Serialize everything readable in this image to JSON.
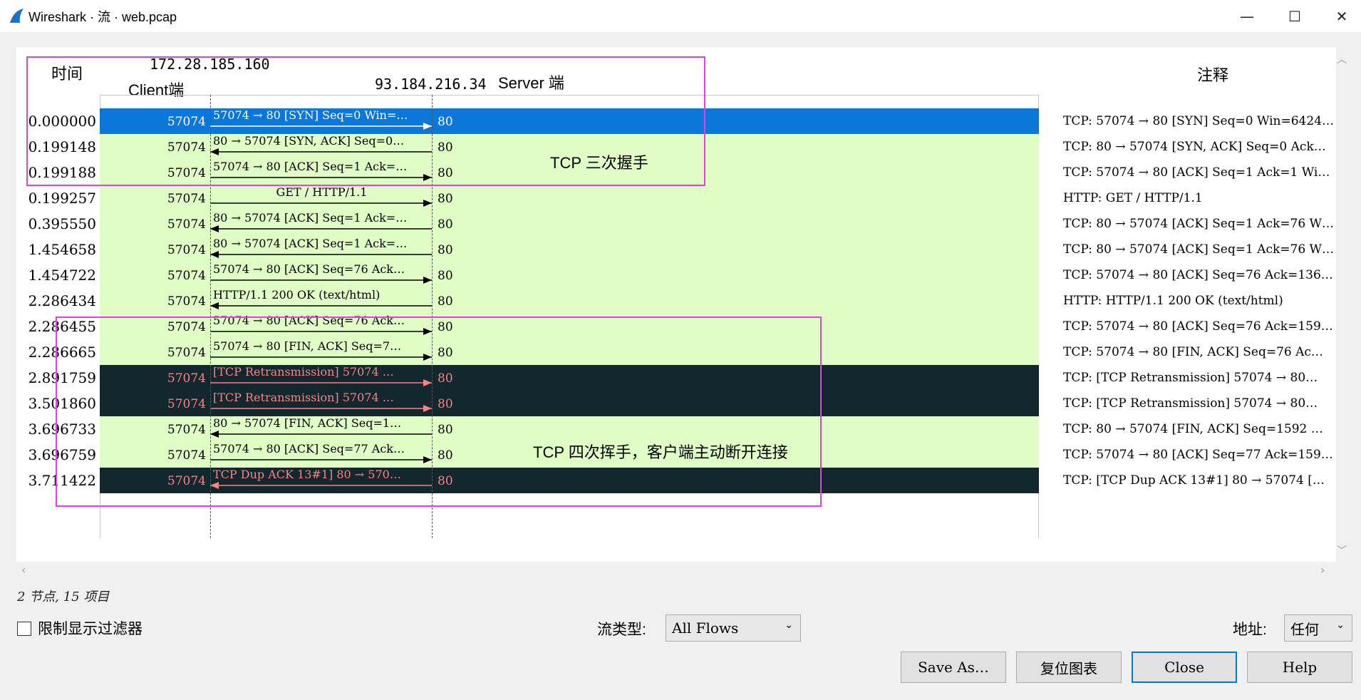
{
  "window": {
    "title": "Wireshark · 流 · web.pcap",
    "minimize": "—",
    "maximize": "☐",
    "close": "✕"
  },
  "header": {
    "time_label": "时间",
    "client_ip": "172.28.185.160",
    "client_label": "Client端",
    "server_ip": "93.184.216.34",
    "server_label": "Server 端",
    "comment_label": "注释"
  },
  "rows": [
    {
      "time": "0.000000",
      "src_port": "57074",
      "dst_port": "80",
      "dir": "right",
      "label": "57074 → 80 [SYN] Seq=0 Win=…",
      "comment": "TCP: 57074 → 80 [SYN] Seq=0 Win=6424…",
      "style": "selected"
    },
    {
      "time": "0.199148",
      "src_port": "57074",
      "dst_port": "80",
      "dir": "left",
      "label": "80 → 57074 [SYN, ACK] Seq=0…",
      "comment": "TCP: 80 → 57074 [SYN, ACK] Seq=0 Ack…",
      "style": "green"
    },
    {
      "time": "0.199188",
      "src_port": "57074",
      "dst_port": "80",
      "dir": "right",
      "label": "57074 → 80 [ACK] Seq=1 Ack=…",
      "comment": "TCP: 57074 → 80 [ACK] Seq=1 Ack=1 Wi…",
      "style": "green"
    },
    {
      "time": "0.199257",
      "src_port": "57074",
      "dst_port": "80",
      "dir": "right",
      "label": "GET / HTTP/1.1",
      "comment": "HTTP: GET / HTTP/1.1",
      "style": "green"
    },
    {
      "time": "0.395550",
      "src_port": "57074",
      "dst_port": "80",
      "dir": "left",
      "label": "80 → 57074 [ACK] Seq=1 Ack=…",
      "comment": "TCP: 80 → 57074 [ACK] Seq=1 Ack=76 W…",
      "style": "green"
    },
    {
      "time": "1.454658",
      "src_port": "57074",
      "dst_port": "80",
      "dir": "left",
      "label": "80 → 57074 [ACK] Seq=1 Ack=…",
      "comment": "TCP: 80 → 57074 [ACK] Seq=1 Ack=76 W…",
      "style": "green"
    },
    {
      "time": "1.454722",
      "src_port": "57074",
      "dst_port": "80",
      "dir": "right",
      "label": "57074 → 80 [ACK] Seq=76 Ack…",
      "comment": "TCP: 57074 → 80 [ACK] Seq=76 Ack=136…",
      "style": "green"
    },
    {
      "time": "2.286434",
      "src_port": "57074",
      "dst_port": "80",
      "dir": "left",
      "label": "HTTP/1.1 200 OK  (text/html)",
      "comment": "HTTP: HTTP/1.1 200 OK  (text/html)",
      "style": "green"
    },
    {
      "time": "2.286455",
      "src_port": "57074",
      "dst_port": "80",
      "dir": "right",
      "label": "57074 → 80 [ACK] Seq=76 Ack…",
      "comment": "TCP: 57074 → 80 [ACK] Seq=76 Ack=159…",
      "style": "green"
    },
    {
      "time": "2.286665",
      "src_port": "57074",
      "dst_port": "80",
      "dir": "right",
      "label": "57074 → 80 [FIN, ACK] Seq=7…",
      "comment": "TCP: 57074 → 80 [FIN, ACK] Seq=76 Ac…",
      "style": "green"
    },
    {
      "time": "2.891759",
      "src_port": "57074",
      "dst_port": "80",
      "dir": "right",
      "label": "[TCP Retransmission] 57074 …",
      "comment": "TCP: [TCP Retransmission] 57074 → 80…",
      "style": "dark"
    },
    {
      "time": "3.501860",
      "src_port": "57074",
      "dst_port": "80",
      "dir": "right",
      "label": "[TCP Retransmission] 57074 …",
      "comment": "TCP: [TCP Retransmission] 57074 → 80…",
      "style": "dark"
    },
    {
      "time": "3.696733",
      "src_port": "57074",
      "dst_port": "80",
      "dir": "left",
      "label": "80 → 57074 [FIN, ACK] Seq=1…",
      "comment": "TCP: 80 → 57074 [FIN, ACK] Seq=1592 …",
      "style": "green"
    },
    {
      "time": "3.696759",
      "src_port": "57074",
      "dst_port": "80",
      "dir": "right",
      "label": "57074 → 80 [ACK] Seq=77 Ack…",
      "comment": "TCP: 57074 → 80 [ACK] Seq=77 Ack=159…",
      "style": "green"
    },
    {
      "time": "3.711422",
      "src_port": "57074",
      "dst_port": "80",
      "dir": "left",
      "label": "TCP Dup ACK 13#1] 80 → 570…",
      "comment": "TCP: [TCP Dup ACK 13#1] 80 → 57074 […",
      "style": "dark"
    }
  ],
  "annotations": {
    "handshake": "TCP 三次握手",
    "teardown": "TCP 四次挥手，客户端主动断开连接"
  },
  "colors": {
    "selected": "#0b77d9",
    "green": "#e0fdc5",
    "dark": "#12272e",
    "dark_text": "#f78383",
    "annotation_box": "#e83ee0"
  },
  "status": "2 节点, 15 项目",
  "footer": {
    "limit_filter_label": "限制显示过滤器",
    "flow_type_label": "流类型:",
    "flow_type_value": "All Flows",
    "address_label": "地址:",
    "address_value": "任何",
    "save_as": "Save As…",
    "reset_chart": "复位图表",
    "close": "Close",
    "help": "Help"
  }
}
